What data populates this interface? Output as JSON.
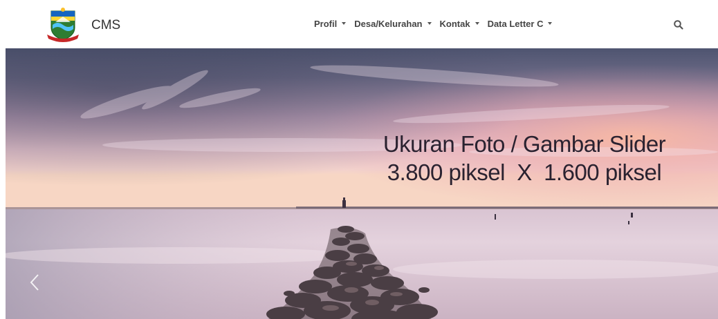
{
  "brand": {
    "name": "CMS",
    "logo_icon": "regency-crest-icon"
  },
  "nav": {
    "items": [
      {
        "label": "Profil"
      },
      {
        "label": "Desa/Kelurahan"
      },
      {
        "label": "Kontak"
      },
      {
        "label": "Data Letter C"
      }
    ],
    "search_icon": "search-icon"
  },
  "slider": {
    "caption_line1": "Ukuran Foto / Gambar Slider",
    "caption_line2": "3.800 piksel  X  1.600 piksel",
    "prev_icon": "chevron-left-icon"
  },
  "colors": {
    "sky_top": "#5b5f78",
    "sky_mid": "#d8b8c8",
    "horizon_glow": "#f6cfc0",
    "sea": "#ddc9d6",
    "text": "#2a2230"
  }
}
